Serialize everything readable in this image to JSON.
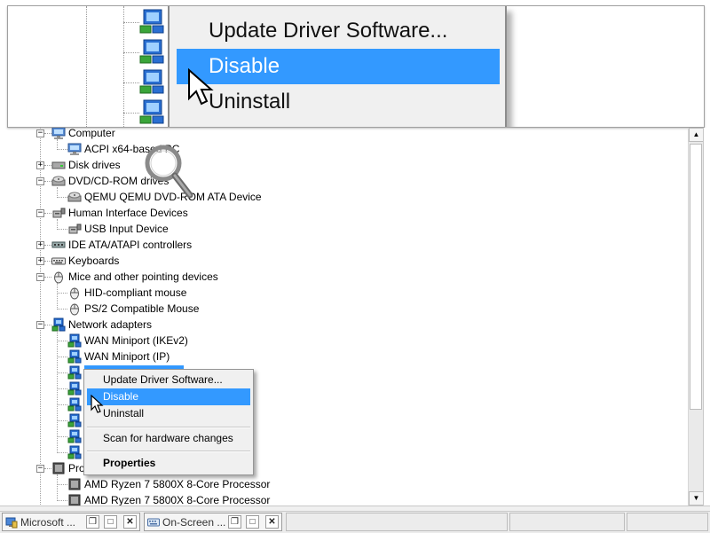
{
  "zoom": {
    "menu_items": [
      "Update Driver Software...",
      "Disable",
      "Uninstall"
    ],
    "selected_index": 1
  },
  "tree": {
    "nodes": [
      {
        "label": "Computer",
        "level": 0,
        "expander": "−",
        "icon": "computer-icon"
      },
      {
        "label": "ACPI x64-based PC",
        "level": 1,
        "icon": "computer-icon"
      },
      {
        "label": "Disk drives",
        "level": 0,
        "expander": "+",
        "icon": "disk-drive-icon"
      },
      {
        "label": "DVD/CD-ROM drives",
        "level": 0,
        "expander": "−",
        "icon": "dvd-drive-icon"
      },
      {
        "label": "QEMU QEMU DVD-ROM ATA Device",
        "level": 1,
        "icon": "dvd-drive-icon"
      },
      {
        "label": "Human Interface Devices",
        "level": 0,
        "expander": "−",
        "icon": "hid-icon"
      },
      {
        "label": "USB Input Device",
        "level": 1,
        "icon": "hid-icon"
      },
      {
        "label": "IDE ATA/ATAPI controllers",
        "level": 0,
        "expander": "+",
        "icon": "ide-controller-icon"
      },
      {
        "label": "Keyboards",
        "level": 0,
        "expander": "+",
        "icon": "keyboard-icon"
      },
      {
        "label": "Mice and other pointing devices",
        "level": 0,
        "expander": "−",
        "icon": "mouse-icon"
      },
      {
        "label": "HID-compliant mouse",
        "level": 1,
        "icon": "mouse-icon"
      },
      {
        "label": "PS/2 Compatible Mouse",
        "level": 1,
        "icon": "mouse-icon"
      },
      {
        "label": "Network adapters",
        "level": 0,
        "expander": "−",
        "icon": "network-adapter-icon"
      },
      {
        "label": "WAN Miniport (IKEv2)",
        "level": 1,
        "icon": "network-adapter-icon"
      },
      {
        "label": "WAN Miniport (IP)",
        "level": 1,
        "icon": "network-adapter-icon"
      },
      {
        "label": "",
        "level": 1,
        "icon": "network-adapter-icon",
        "selected": true
      },
      {
        "label": "",
        "level": 1,
        "icon": "network-adapter-icon"
      },
      {
        "label": "",
        "level": 1,
        "icon": "network-adapter-icon"
      },
      {
        "label": "",
        "level": 1,
        "icon": "network-adapter-icon"
      },
      {
        "label": "",
        "level": 1,
        "icon": "network-adapter-icon"
      },
      {
        "label": "",
        "level": 1,
        "icon": "network-adapter-icon"
      },
      {
        "label": "Pro",
        "level": 0,
        "expander": "−",
        "icon": "processor-icon"
      },
      {
        "label": "AMD Ryzen 7 5800X 8-Core Processor",
        "level": 1,
        "icon": "processor-icon"
      },
      {
        "label": "AMD Ryzen 7 5800X 8-Core Processor",
        "level": 1,
        "icon": "processor-icon"
      }
    ]
  },
  "context_menu": {
    "update": "Update Driver Software...",
    "disable": "Disable",
    "uninstall": "Uninstall",
    "scan": "Scan for hardware changes",
    "properties": "Properties"
  },
  "taskbar": {
    "windows": [
      {
        "title": "Microsoft ...",
        "icon": "management-console-icon"
      },
      {
        "title": "On-Screen ...",
        "icon": "keyboard-icon"
      }
    ]
  },
  "colors": {
    "selection": "#3399ff",
    "menu_bg": "#f0f0f0"
  }
}
